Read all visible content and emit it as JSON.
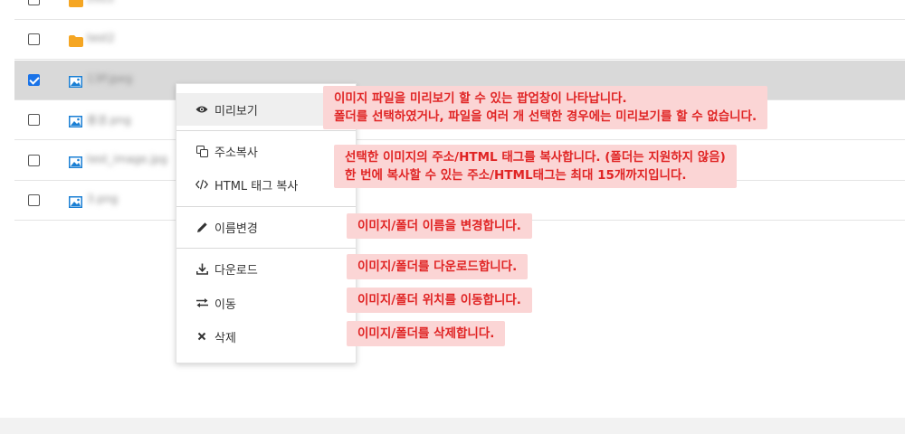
{
  "file_list": {
    "rows": [
      {
        "name": "2022",
        "type": "folder",
        "checked": false
      },
      {
        "name": "test2",
        "type": "folder",
        "checked": false
      },
      {
        "name": "13P.jpeg",
        "type": "image",
        "checked": true
      },
      {
        "name": "풍경.png",
        "type": "image",
        "checked": false
      },
      {
        "name": "test_image.jpg",
        "type": "image",
        "checked": false
      },
      {
        "name": "3.png",
        "type": "image",
        "checked": false
      }
    ]
  },
  "context_menu": {
    "preview": "미리보기",
    "copy_address": "주소복사",
    "copy_html": "HTML 태그 복사",
    "rename": "이름변경",
    "download": "다운로드",
    "move": "이동",
    "delete": "삭제"
  },
  "annotations": {
    "preview_line1": "이미지 파일을 미리보기 할 수 있는 팝업창이 나타납니다.",
    "preview_line2": "폴더를 선택하였거나, 파일을 여러 개 선택한 경우에는 미리보기를 할 수 없습니다.",
    "copy_line1": "선택한 이미지의 주소/HTML 태그를 복사합니다. (폴더는 지원하지 않음)",
    "copy_line2": "한 번에 복사할 수 있는 주소/HTML태그는 최대 15개까지입니다.",
    "rename": "이미지/폴더 이름을 변경합니다.",
    "download": "이미지/폴더를 다운로드합니다.",
    "move": "이미지/폴더 위치를 이동합니다.",
    "delete": "이미지/폴더를 삭제합니다."
  },
  "colors": {
    "folder": "#f5a623",
    "image": "#1a7fd4",
    "annotation_bg": "#fbd5d5",
    "annotation_text": "#e02424",
    "selected_row": "#d9d9d9"
  }
}
